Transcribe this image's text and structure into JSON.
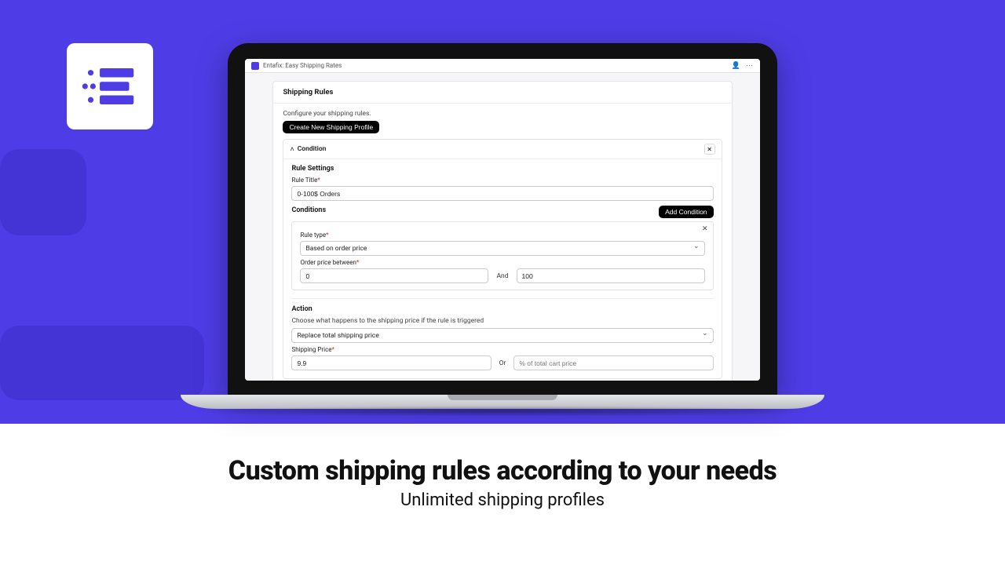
{
  "titlebar": {
    "app_name": "Entafix: Easy Shipping Rates"
  },
  "card": {
    "title": "Shipping Rules",
    "subtitle": "Configure your shipping rules.",
    "create_btn": "Create New Shipping Profile"
  },
  "panel": {
    "header": "Condition",
    "rule_settings": "Rule Settings",
    "rule_title_label": "Rule Title",
    "rule_title_value": "0-100$ Orders",
    "conditions_label": "Conditions",
    "add_condition_btn": "Add Condition"
  },
  "condition": {
    "rule_type_label": "Rule type",
    "rule_type_value": "Based on order price",
    "price_between_label": "Order price between",
    "price_min": "0",
    "and_label": "And",
    "price_max": "100"
  },
  "action": {
    "heading": "Action",
    "desc": "Choose what happens to the shipping price if the rule is triggered",
    "type_value": "Replace total shipping price",
    "shipping_price_label": "Shipping Price",
    "shipping_price_value": "9.9",
    "or_label": "Or",
    "percent_placeholder": "% of total cart price"
  },
  "marketing": {
    "headline": "Custom shipping rules according to your needs",
    "subhead": "Unlimited shipping profiles"
  }
}
